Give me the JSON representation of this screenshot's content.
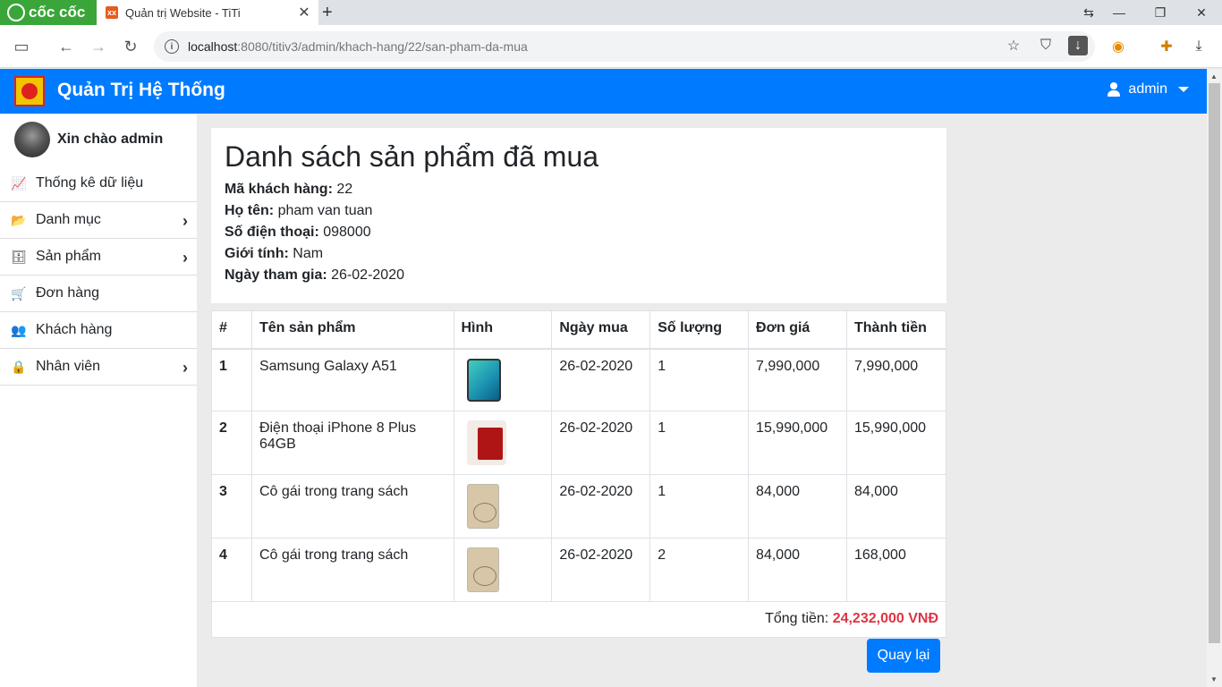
{
  "browser": {
    "brand_label": "cốc cốc",
    "tab_title": "Quản trị Website - TiTi",
    "tab_icon_text": "xx",
    "url_host": "localhost",
    "url_path": ":8080/titiv3/admin/khach-hang/22/san-pham-da-mua"
  },
  "navbar": {
    "title": "Quản Trị Hệ Thống",
    "user_label": "admin",
    "bg_color": "#007bff"
  },
  "sidebar": {
    "greeting": "Xin chào admin",
    "items": [
      {
        "label": "Thống kê dữ liệu",
        "icon": "chart-line-icon",
        "glyph": "📈",
        "arrow": false
      },
      {
        "label": "Danh mục",
        "icon": "folder-open-icon",
        "glyph": "📂",
        "arrow": true
      },
      {
        "label": "Sản phẩm",
        "icon": "database-icon",
        "glyph": "🗄",
        "arrow": true
      },
      {
        "label": "Đơn hàng",
        "icon": "cart-icon",
        "glyph": "🛒",
        "arrow": false
      },
      {
        "label": "Khách hàng",
        "icon": "users-icon",
        "glyph": "👥",
        "arrow": false
      },
      {
        "label": "Nhân viên",
        "icon": "user-lock-icon",
        "glyph": "🔒",
        "arrow": true
      }
    ]
  },
  "main": {
    "title": "Danh sách sản phẩm đã mua",
    "customer": {
      "id_label": "Mã khách hàng:",
      "id": "22",
      "name_label": "Họ tên:",
      "name": "pham van tuan",
      "phone_label": "Số điện thoại:",
      "phone": "098000",
      "gender_label": "Giới tính:",
      "gender": "Nam",
      "joined_label": "Ngày tham gia:",
      "joined": "26-02-2020"
    },
    "table": {
      "headers": [
        "#",
        "Tên sản phẩm",
        "Hình",
        "Ngày mua",
        "Số lượng",
        "Đơn giá",
        "Thành tiền"
      ],
      "rows": [
        {
          "no": "1",
          "name": "Samsung Galaxy A51",
          "date": "26-02-2020",
          "qty": "1",
          "price": "7,990,000",
          "total": "7,990,000",
          "image": "phone-teal"
        },
        {
          "no": "2",
          "name": "Điện thoại iPhone 8 Plus 64GB",
          "date": "26-02-2020",
          "qty": "1",
          "price": "15,990,000",
          "total": "15,990,000",
          "image": "phone-red"
        },
        {
          "no": "3",
          "name": "Cô gái trong trang sách",
          "date": "26-02-2020",
          "qty": "1",
          "price": "84,000",
          "total": "84,000",
          "image": "book"
        },
        {
          "no": "4",
          "name": "Cô gái trong trang sách",
          "date": "26-02-2020",
          "qty": "2",
          "price": "84,000",
          "total": "168,000",
          "image": "book"
        }
      ],
      "total_label": "Tổng tiền:",
      "total_value": "24,232,000 VNĐ"
    },
    "back_button": "Quay lại"
  }
}
